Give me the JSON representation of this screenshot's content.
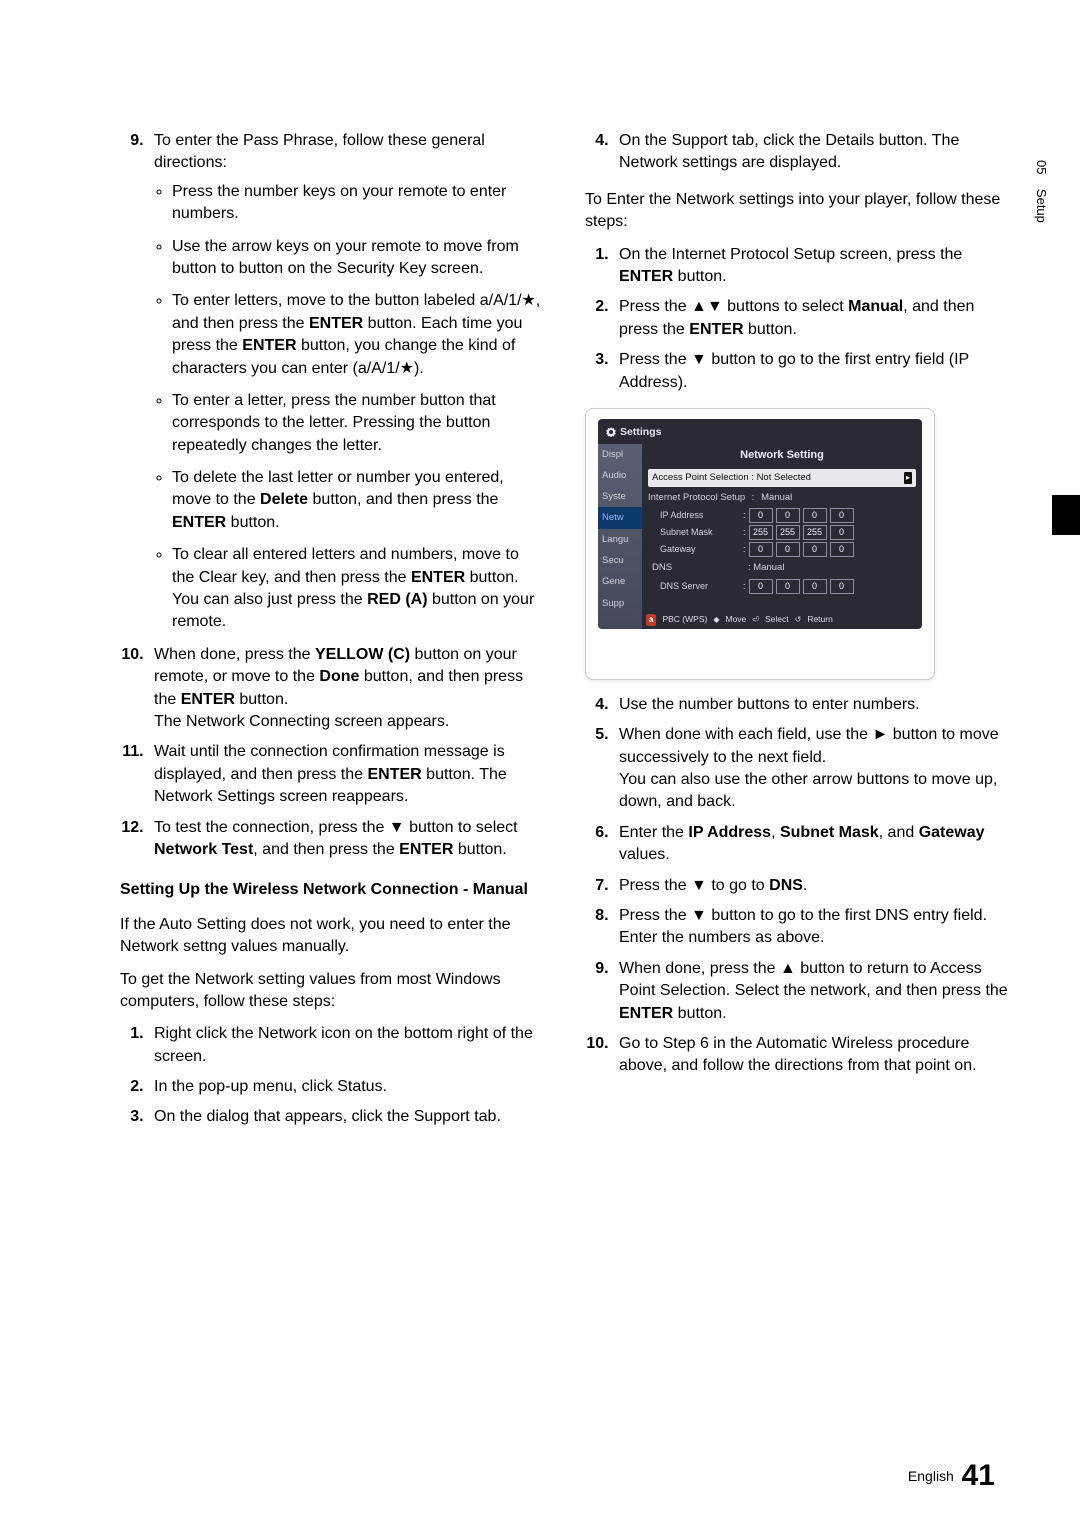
{
  "sideTab": {
    "chapter": "05",
    "title": "Setup"
  },
  "left": {
    "startNum": 9,
    "item9": {
      "lead": "To enter the Pass Phrase, follow these general directions:",
      "bullets": [
        "Press the number keys on your remote to enter numbers.",
        "Use the arrow keys on your remote to move from button to button on the Security Key screen.",
        {
          "pre": "To enter letters, move to the button labeled a/A/1/★, and then press the ",
          "b1": "ENTER",
          "mid": " button. Each time you press the ",
          "b2": "ENTER",
          "post": " button, you change the kind of characters you can enter (a/A/1/★)."
        },
        "To enter a letter, press the number button that corresponds to the letter. Pressing the button repeatedly changes the letter.",
        {
          "pre": "To delete the last letter or number you entered, move to the ",
          "b1": "Delete",
          "mid": " button, and then press the ",
          "b2": "ENTER",
          "post": " button."
        },
        {
          "pre": "To clear all entered letters and numbers, move to the Clear key, and then press the ",
          "b1": "ENTER",
          "mid": " button. You can also just press the ",
          "b2": "RED (A)",
          "post": " button on your remote."
        }
      ]
    },
    "item10": {
      "pre": "When done, press the ",
      "b1": "YELLOW (C)",
      "mid1": " button on your remote, or move to the ",
      "b2": "Done",
      "mid2": " button, and then press the ",
      "b3": "ENTER",
      "post": " button.\nThe Network Connecting screen appears."
    },
    "item11": {
      "pre": "Wait until the connection confirmation message is displayed, and then press the ",
      "b1": "ENTER",
      "post": " button. The Network Settings screen reappears."
    },
    "item12": {
      "pre": "To test the connection, press the ▼ button to select ",
      "b1": "Network Test",
      "mid": ", and then press the ",
      "b2": "ENTER",
      "post": " button."
    },
    "sectionHead": "Setting Up the Wireless Network Connection - Manual",
    "para1": "If the Auto Setting does not work, you need to enter the Network settng values manually.",
    "para2": "To get the Network setting values from most Windows computers, follow these steps:",
    "steps2": [
      "Right click the Network icon on the bottom right of the screen.",
      "In the pop-up menu, click Status.",
      "On the dialog that appears, click the Support tab."
    ]
  },
  "right": {
    "cont4": "On the Support tab, click the Details button. The Network settings are displayed.",
    "intro": "To Enter the Network settings into your player, follow these steps:",
    "steps": {
      "s1": {
        "pre": "On the Internet Protocol Setup screen, press the ",
        "b1": "ENTER",
        "post": " button."
      },
      "s2": {
        "pre": "Press the ▲▼ buttons to select ",
        "b1": "Manual",
        "mid": ", and then press the ",
        "b2": "ENTER",
        "post": " button."
      },
      "s3": "Press the ▼ button to go to the first entry field (IP Address).",
      "s4": "Use the number buttons to enter numbers.",
      "s5": "When done with each field, use the ► button to move successively to the next field.\nYou can also use the other arrow buttons to move up, down, and back.",
      "s6": {
        "pre": "Enter the ",
        "b1": "IP Address",
        "mid1": ", ",
        "b2": "Subnet Mask",
        "mid2": ", and ",
        "b3": "Gateway",
        "post": " values."
      },
      "s7": {
        "pre": "Press the ▼ to go to ",
        "b1": "DNS",
        "post": "."
      },
      "s8": "Press the ▼ button to go to the first DNS entry field. Enter the numbers as above.",
      "s9": {
        "pre": "When done, press the ▲ button to return to Access Point Selection. Select the network, and then press the ",
        "b1": "ENTER",
        "post": " button."
      },
      "s10": "Go to Step 6 in the Automatic Wireless procedure above, and follow the directions from that point on."
    }
  },
  "osd": {
    "header": "Settings",
    "side": [
      "Displ",
      "Audio",
      "Syste",
      "Netw",
      "Langu",
      "Secu",
      "Gene",
      "Supp"
    ],
    "activeIdx": 3,
    "title": "Network Setting",
    "apRow": {
      "label": "Access Point Selection",
      "value": "Not Selected"
    },
    "ipsRow": {
      "label": "Internet Protocol Setup",
      "value": "Manual"
    },
    "rows": [
      {
        "label": "IP Address",
        "vals": [
          "0",
          "0",
          "0",
          "0"
        ]
      },
      {
        "label": "Subnet Mask",
        "vals": [
          "255",
          "255",
          "255",
          "0"
        ]
      },
      {
        "label": "Gateway",
        "vals": [
          "0",
          "0",
          "0",
          "0"
        ]
      }
    ],
    "dnsRow": {
      "label": "DNS",
      "value": "Manual"
    },
    "dnsServer": {
      "label": "DNS Server",
      "vals": [
        "0",
        "0",
        "0",
        "0"
      ]
    },
    "foot": {
      "aKey": "a",
      "pbc": "PBC (WPS)",
      "move": "Move",
      "select": "Select",
      "ret": "Return"
    }
  },
  "footer": {
    "lang": "English",
    "page": "41"
  }
}
